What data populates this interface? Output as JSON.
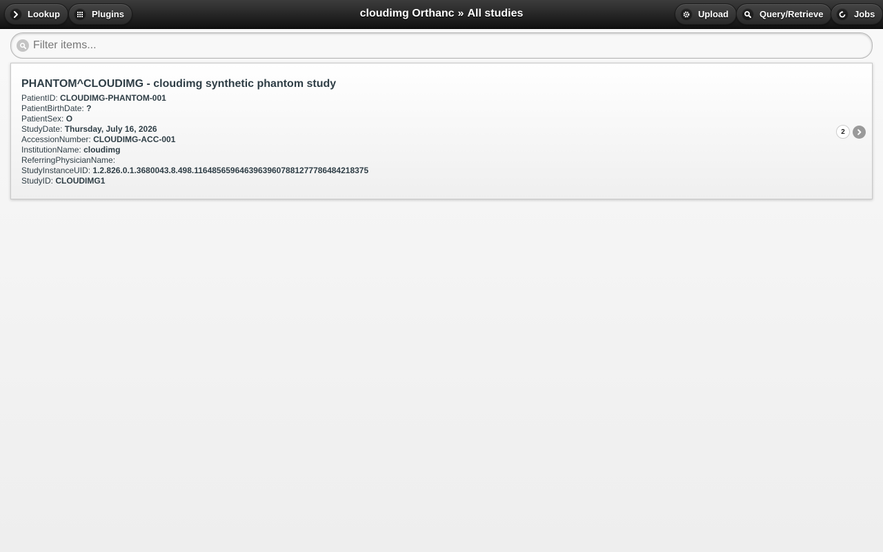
{
  "header": {
    "left_buttons": [
      {
        "label": "Lookup",
        "icon": "chevron-right-icon"
      },
      {
        "label": "Plugins",
        "icon": "grid-icon"
      }
    ],
    "title": {
      "app": "cloudimg Orthanc",
      "separator": "»",
      "page": "All studies"
    },
    "right_buttons": [
      {
        "label": "Upload",
        "icon": "gear-icon"
      },
      {
        "label": "Query/Retrieve",
        "icon": "search-icon"
      },
      {
        "label": "Jobs",
        "icon": "refresh-icon"
      }
    ]
  },
  "filter": {
    "placeholder": "Filter items...",
    "value": ""
  },
  "studies": [
    {
      "title": "PHANTOM^CLOUDIMG - cloudimg synthetic phantom study",
      "fields": [
        {
          "label": "PatientID:",
          "value": "CLOUDIMG-PHANTOM-001"
        },
        {
          "label": "PatientBirthDate:",
          "value": "?"
        },
        {
          "label": "PatientSex:",
          "value": "O"
        },
        {
          "label": "StudyDate:",
          "value": "Thursday, July 16, 2026"
        },
        {
          "label": "AccessionNumber:",
          "value": "CLOUDIMG-ACC-001"
        },
        {
          "label": "InstitutionName:",
          "value": "cloudimg"
        },
        {
          "label": "ReferringPhysicianName:",
          "value": ""
        },
        {
          "label": "StudyInstanceUID:",
          "value": "1.2.826.0.1.3680043.8.498.11648565964639639607881277786484218375"
        },
        {
          "label": "StudyID:",
          "value": "CLOUDIMG1"
        }
      ],
      "count": "2"
    }
  ],
  "colors": {
    "header_bg": "#1e1e1e",
    "text_dark": "#2f3e46",
    "page_bg": "#f3f3f3"
  }
}
